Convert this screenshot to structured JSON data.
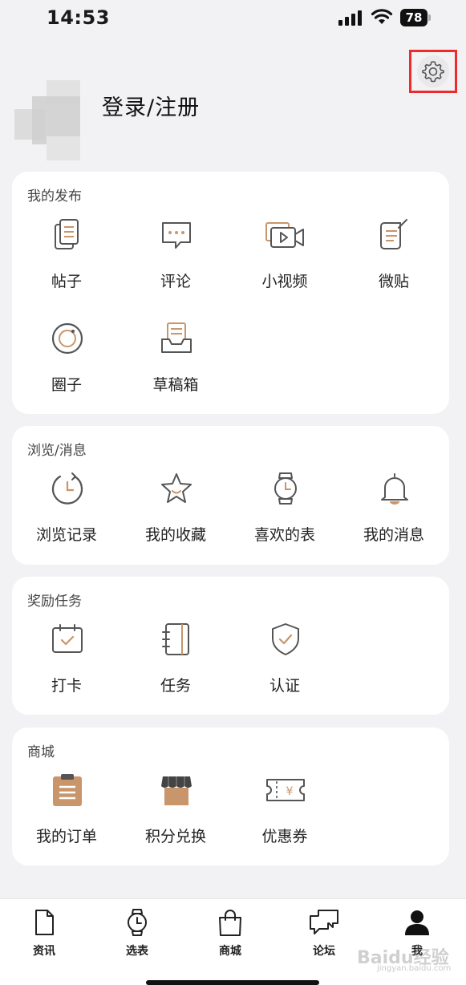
{
  "status": {
    "time": "14:53",
    "battery": "78"
  },
  "profile": {
    "login_label": "登录/注册"
  },
  "sections": [
    {
      "title": "我的发布",
      "items": [
        "帖子",
        "评论",
        "小视频",
        "微贴",
        "圈子",
        "草稿箱"
      ]
    },
    {
      "title": "浏览/消息",
      "items": [
        "浏览记录",
        "我的收藏",
        "喜欢的表",
        "我的消息"
      ]
    },
    {
      "title": "奖励任务",
      "items": [
        "打卡",
        "任务",
        "认证"
      ]
    },
    {
      "title": "商城",
      "items": [
        "我的订单",
        "积分兑换",
        "优惠券"
      ]
    }
  ],
  "bottom_nav": [
    {
      "label": "资讯",
      "icon": "document-icon"
    },
    {
      "label": "选表",
      "icon": "watch-icon"
    },
    {
      "label": "商城",
      "icon": "shopping-bag-icon"
    },
    {
      "label": "论坛",
      "icon": "chat-bubbles-icon"
    },
    {
      "label": "我",
      "icon": "person-icon",
      "active": true
    }
  ],
  "watermark": {
    "text": "Baidu经验",
    "sub": "jingyan.baidu.com"
  },
  "colors": {
    "accent": "#c9956a",
    "icon_gray": "#555555",
    "highlight_border": "#ee2b2b"
  }
}
